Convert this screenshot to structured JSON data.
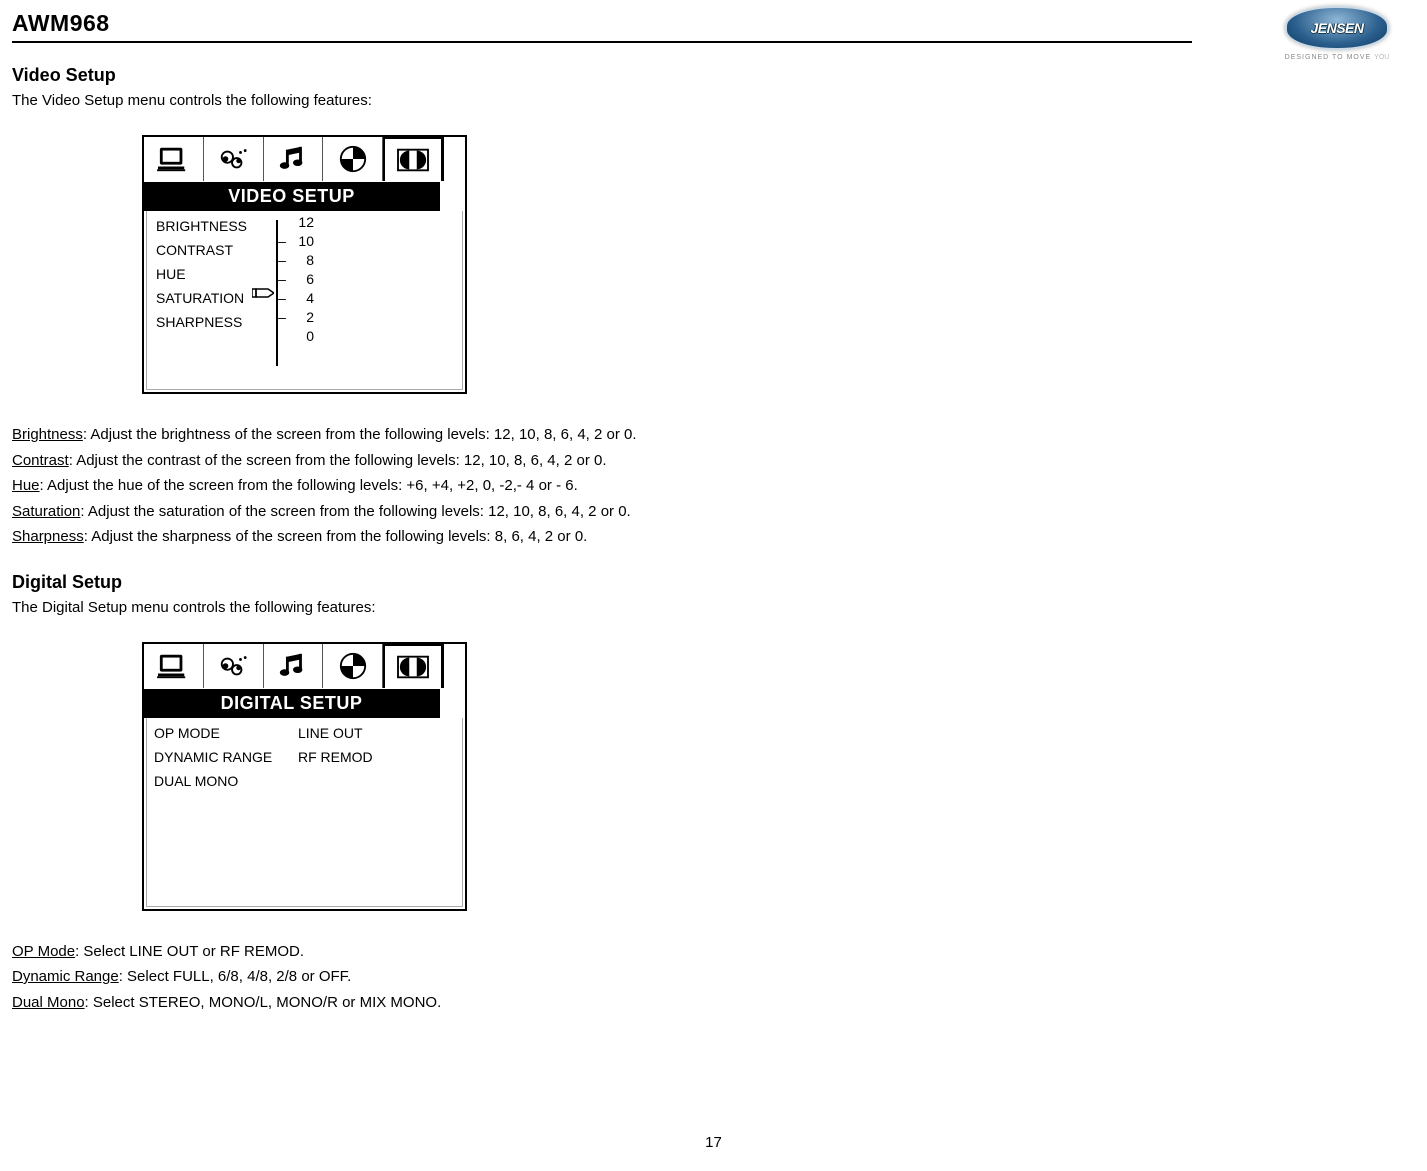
{
  "header": {
    "model": "AWM968",
    "brand": "JENSEN",
    "tagline_main": "DESIGNED TO MOVE",
    "tagline_accent": "YOU"
  },
  "video_section": {
    "heading": "Video Setup",
    "intro": "The Video Setup menu controls the following features:",
    "menu_title": "VIDEO SETUP",
    "items": [
      "BRIGHTNESS",
      "CONTRAST",
      "HUE",
      "SATURATION",
      "SHARPNESS"
    ],
    "scale": [
      "12",
      "10",
      "8",
      "6",
      "4",
      "2",
      "0"
    ],
    "params": [
      {
        "term": "Brightness",
        "desc": ": Adjust the brightness of the screen from the following levels: 12, 10, 8, 6, 4, 2 or 0."
      },
      {
        "term": "Contrast",
        "desc": ": Adjust the contrast of the screen from the following levels: 12, 10, 8, 6, 4, 2 or 0."
      },
      {
        "term": "Hue",
        "desc": ": Adjust the hue of the screen from the following levels: +6, +4, +2, 0, -2,- 4 or - 6."
      },
      {
        "term": "Saturation",
        "desc": ": Adjust the saturation of the screen from the following levels: 12, 10, 8, 6, 4, 2 or 0."
      },
      {
        "term": "Sharpness",
        "desc": ": Adjust the sharpness of the screen from the following levels: 8, 6, 4, 2 or 0."
      }
    ]
  },
  "digital_section": {
    "heading": "Digital Setup",
    "intro": "The Digital Setup menu controls the following features:",
    "menu_title": "DIGITAL SETUP",
    "left_items": [
      "OP MODE",
      "DYNAMIC RANGE",
      "DUAL MONO"
    ],
    "right_items": [
      "LINE OUT",
      "RF REMOD"
    ],
    "params": [
      {
        "term": "OP Mode",
        "desc": ": Select LINE OUT or RF REMOD."
      },
      {
        "term": "Dynamic Range",
        "desc": ": Select FULL, 6/8, 4/8, 2/8 or OFF."
      },
      {
        "term": "Dual Mono",
        "desc": ": Select STEREO, MONO/L, MONO/R or MIX MONO."
      }
    ]
  },
  "page_number": "17"
}
